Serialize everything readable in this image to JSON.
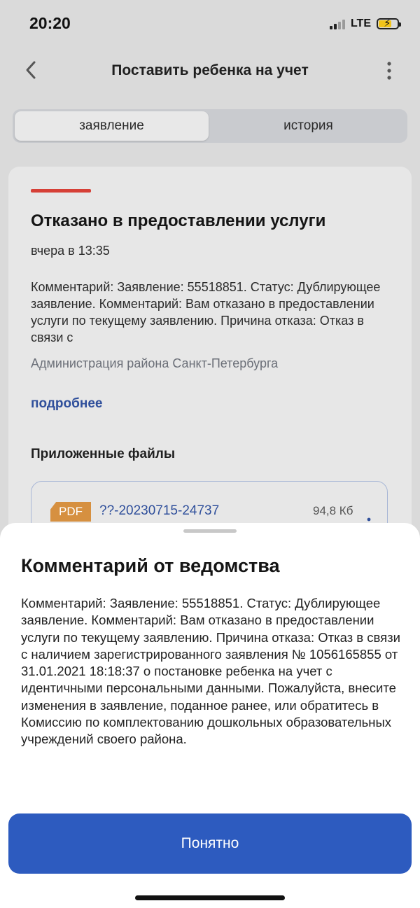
{
  "status_bar": {
    "time": "20:20",
    "network": "LTE"
  },
  "header": {
    "title": "Поставить ребенка на учет",
    "back_icon": "chevron-left-icon",
    "menu_icon": "more-vertical-icon"
  },
  "tabs": [
    {
      "label": "заявление",
      "active": true
    },
    {
      "label": "история",
      "active": false
    }
  ],
  "card": {
    "accent_color": "#d64037",
    "title": "Отказано в предоставлении услуги",
    "date": "вчера в 13:35",
    "comment": "Комментарий: Заявление: 55518851. Статус: Дублирующее заявление. Комментарий: Вам отказано в предоставлении услуги по текущему заявлению. Причина отказа: Отказ в связи с",
    "organization": "Администрация района Санкт-Петербурга",
    "more_link": "подробнее",
    "files_title": "Приложенные файлы",
    "file": {
      "type_badge": "PDF",
      "name": "??-20230715-24737",
      "size": "94,8 Кб"
    }
  },
  "sheet": {
    "title": "Комментарий от ведомства",
    "body": "Комментарий: Заявление: 55518851. Статус: Дублирующее заявление. Комментарий: Вам отказано в предоставлении услуги по текущему заявлению. Причина отказа: Отказ в связи с наличием зарегистрированного заявления № 1056165855 от 31.01.2021 18:18:37 о постановке ребенка на учет с идентичными персональными данными. Пожалуйста, внесите изменения в заявление, поданное ранее, или обратитесь в Комиссию по комплектованию дошкольных образовательных учреждений своего района.",
    "button_label": "Понятно",
    "button_color": "#2d5bbf"
  }
}
